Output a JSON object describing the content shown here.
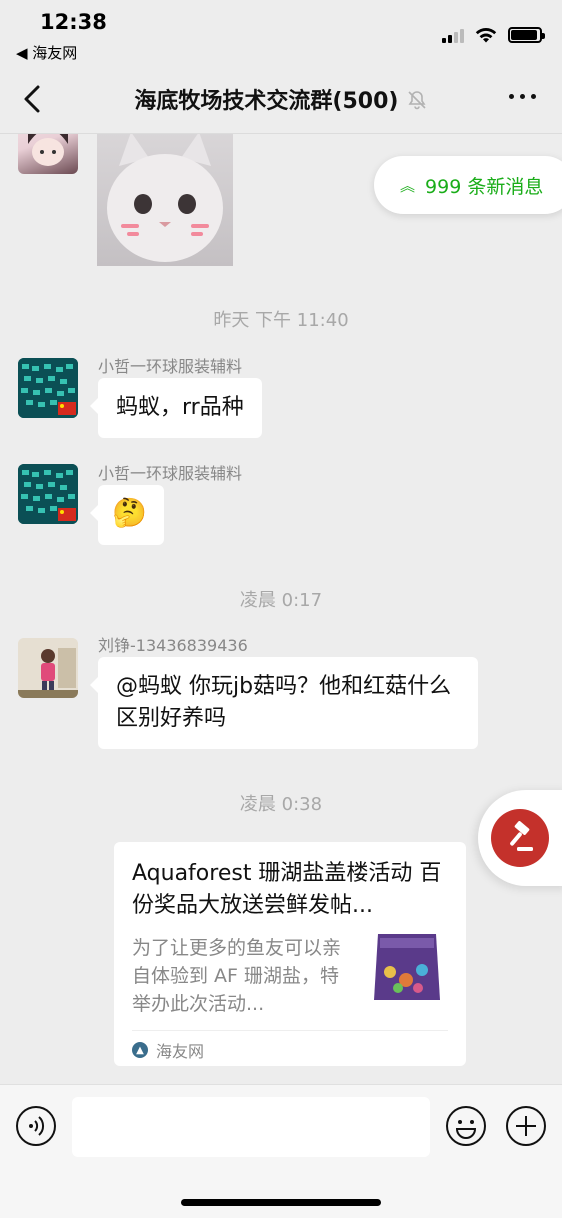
{
  "status_bar": {
    "time": "12:38",
    "back_app": "◀ 海友网"
  },
  "nav": {
    "title": "海底牧场技术交流群(500)",
    "back_icon": "chevron-left-icon",
    "mute_icon": "bell-off-icon",
    "more_icon": "ellipsis-icon"
  },
  "new_messages": {
    "label": "999 条新消息"
  },
  "messages": {
    "ts1": "昨天 下午 11:40",
    "m1_sender": "小哲一环球服装辅料",
    "m1_text": "蚂蚁，rr品种",
    "m2_sender": "小哲一环球服装辅料",
    "m2_emoji": "🤔",
    "ts2": "凌晨 0:17",
    "m3_sender": "刘铮-13436839436",
    "m3_text": "@蚂蚁 你玩jb菇吗？他和红菇什么区别好养吗",
    "ts3": "凌晨 0:38"
  },
  "link_card": {
    "title": "Aquaforest 珊湖盐盖楼活动 百份奖品大放送尝鲜发帖...",
    "description": "为了让更多的鱼友可以亲自体验到 AF 珊湖盐，特举办此次活动...",
    "source": "海友网"
  },
  "colors": {
    "accent_green": "#1aad19",
    "float_red": "#c4312b",
    "background": "#ededed"
  }
}
